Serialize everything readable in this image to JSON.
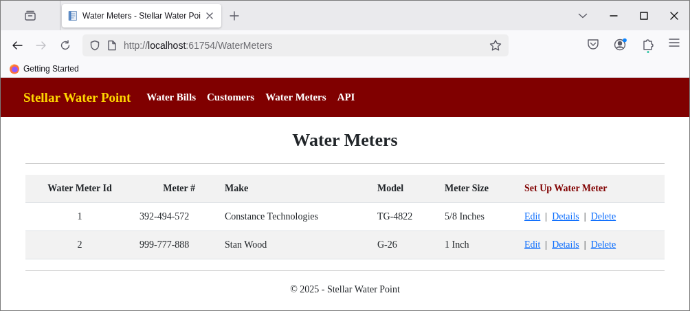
{
  "browser": {
    "tabs": [
      {
        "title": "Water Meters - Stellar Water Poi",
        "selected": true
      }
    ],
    "nav": {
      "back_disabled": false,
      "forward_disabled": true
    },
    "url": {
      "scheme": "http://",
      "host": "localhost",
      "path": ":61754/WaterMeters"
    },
    "bookmarks": [
      {
        "label": "Getting Started"
      }
    ]
  },
  "site": {
    "brand": "Stellar Water Point",
    "links": [
      {
        "label": "Water Bills"
      },
      {
        "label": "Customers"
      },
      {
        "label": "Water Meters"
      },
      {
        "label": "API"
      }
    ]
  },
  "page": {
    "title": "Water Meters",
    "table": {
      "columns": [
        {
          "label": "Water Meter Id",
          "kind": "text"
        },
        {
          "label": "Meter #",
          "kind": "text"
        },
        {
          "label": "Make",
          "kind": "text"
        },
        {
          "label": "Model",
          "kind": "text"
        },
        {
          "label": "Meter Size",
          "kind": "text"
        },
        {
          "label": "Set Up Water Meter",
          "kind": "link"
        }
      ],
      "rows": [
        {
          "cells": [
            "1",
            "392-494-572",
            "Constance Technologies",
            "TG-4822",
            "5/8 Inches"
          ],
          "actions": [
            {
              "kind": "link",
              "text": "Edit"
            },
            {
              "kind": "separator",
              "text": "|"
            },
            {
              "kind": "link",
              "text": "Details"
            },
            {
              "kind": "separator",
              "text": "|"
            },
            {
              "kind": "link",
              "text": "Delete"
            }
          ]
        },
        {
          "cells": [
            "2",
            "999-777-888",
            "Stan Wood",
            "G-26",
            "1 Inch"
          ],
          "actions": [
            {
              "kind": "link",
              "text": "Edit"
            },
            {
              "kind": "separator",
              "text": "|"
            },
            {
              "kind": "link",
              "text": "Details"
            },
            {
              "kind": "separator",
              "text": "|"
            },
            {
              "kind": "link",
              "text": "Delete"
            }
          ]
        }
      ]
    },
    "footer": "© 2025 - Stellar Water Point"
  }
}
